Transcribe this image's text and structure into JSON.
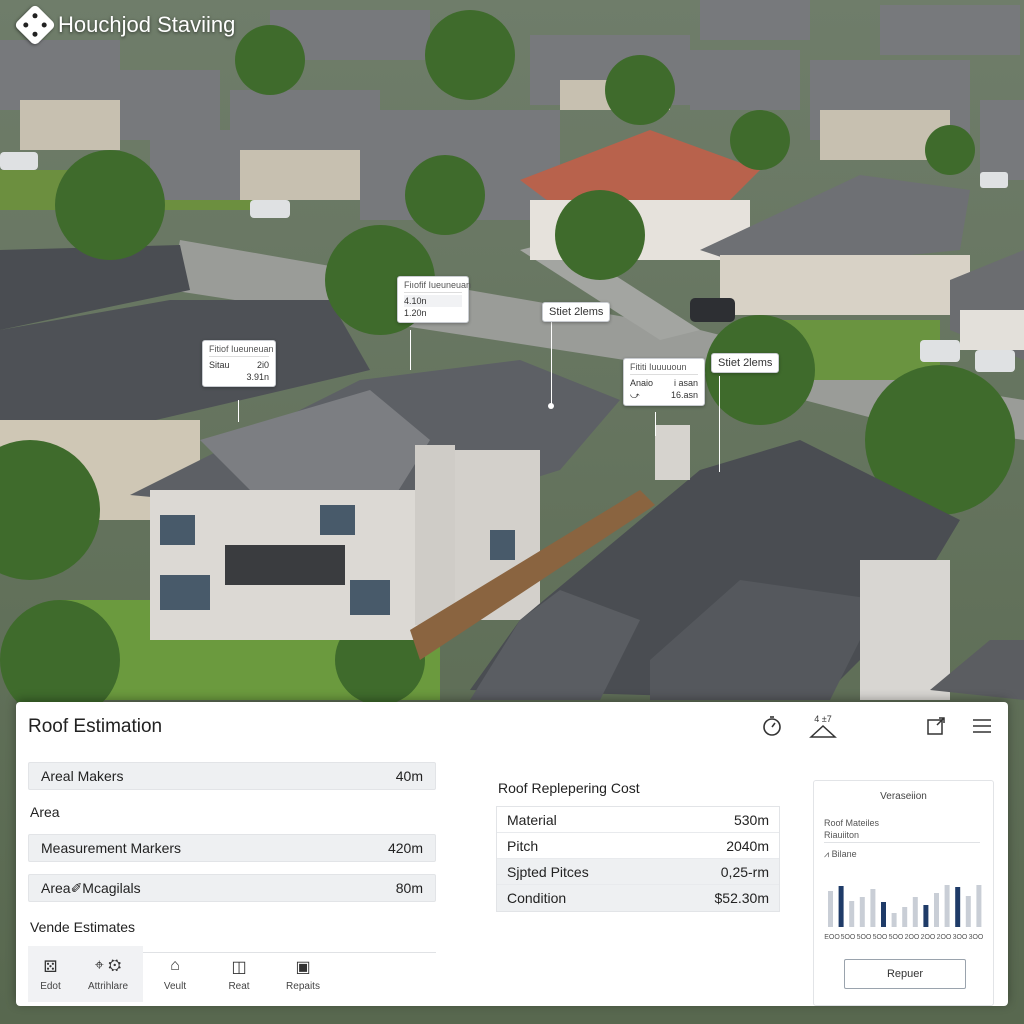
{
  "app": {
    "title": "Houchjod Staviing"
  },
  "callouts": [
    {
      "title": "Fiıofif Iueuneuan",
      "rows": [
        {
          "icon": "ruler-icon",
          "label": "4.10n"
        },
        {
          "icon": "angle-icon",
          "label": "1.20n"
        }
      ]
    },
    {
      "title": "Stiet 2lems",
      "rows": []
    },
    {
      "title": "Fitiof Iueuneuan",
      "rows": [
        {
          "label": "Sitau",
          "value": "2i0"
        },
        {
          "label": "",
          "value": "3.91n"
        }
      ]
    },
    {
      "title": "Fititi Iuuuuoun",
      "rows": [
        {
          "label": "Anaio",
          "value": "i asan"
        },
        {
          "icon": "pitch-icon",
          "label": "",
          "value": "16.asn"
        }
      ]
    },
    {
      "title": "Stiet 2lems",
      "rows": []
    }
  ],
  "panel": {
    "title": "Roof Estimation",
    "header_icons": [
      "timer-icon",
      "angle-measure-icon",
      "export-icon",
      "menu-icon"
    ],
    "header_icon_label": "4 ±7",
    "left": {
      "rows": [
        {
          "label": "Areal Makers",
          "value": "40m"
        }
      ],
      "area_label": "Area",
      "rows2": [
        {
          "label": "Measurement Markers",
          "value": "420m"
        },
        {
          "label": "Area✐Mcagilals",
          "value": "80m"
        }
      ],
      "estimates_label": "Vende Estimates"
    },
    "toolbar": [
      {
        "label": "Edot",
        "icon": "edit-icon"
      },
      {
        "label": "Attrihlare",
        "icon": "attribute-icon"
      },
      {
        "label": "Veult",
        "icon": "home-icon"
      },
      {
        "label": "Reat",
        "icon": "camera-icon"
      },
      {
        "label": "Repaits",
        "icon": "report-icon"
      }
    ],
    "cost": {
      "title": "Roof Replepering Cost",
      "rows": [
        {
          "label": "Material",
          "value": "530m"
        },
        {
          "label": "Pitch",
          "value": "2040m"
        },
        {
          "label": "Sjpted Pitces",
          "value": "0,25-rm"
        },
        {
          "label": "Condition",
          "value": "$52.30m"
        }
      ]
    },
    "chart_card": {
      "heading": "Veraseiion",
      "sub1": "Roof Mateiles",
      "sub2": "Riauiiton",
      "sub3": "Bilane",
      "button": "Repuer"
    }
  },
  "chart_data": {
    "type": "bar",
    "categories": [
      "ЕОО",
      "5ОО",
      "5ОО",
      "5ОО",
      "5ОО",
      "2ОО",
      "2ОО",
      "2ОО",
      "3ОО",
      "3ОО"
    ],
    "series": [
      {
        "values": [
          0.72,
          0.82,
          0.52,
          0.6,
          0.76,
          0.5,
          0.28,
          0.4,
          0.6,
          0.44,
          0.68,
          0.84,
          0.8,
          0.62,
          0.84
        ]
      }
    ],
    "colors": {
      "light": "#c9ced6",
      "dark": "#1f3b68"
    },
    "dark_index": [
      1,
      5,
      9,
      12
    ]
  }
}
